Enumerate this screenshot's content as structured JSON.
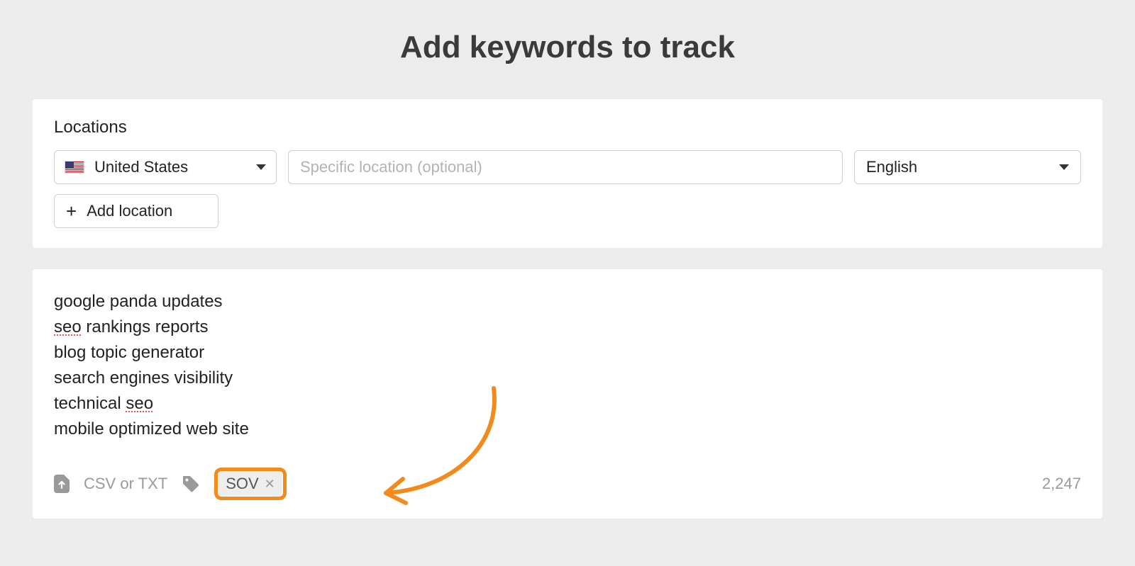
{
  "title": "Add keywords to track",
  "locations": {
    "label": "Locations",
    "country": "United States",
    "specific_placeholder": "Specific location (optional)",
    "language": "English",
    "add_button": "Add location"
  },
  "keywords": {
    "lines": [
      "google panda updates",
      "seo rankings reports",
      "blog topic generator",
      "search engines visibility",
      "technical seo",
      "mobile optimized web site"
    ]
  },
  "footer": {
    "upload_label": "CSV or TXT",
    "tag": "SOV",
    "count": "2,247"
  }
}
